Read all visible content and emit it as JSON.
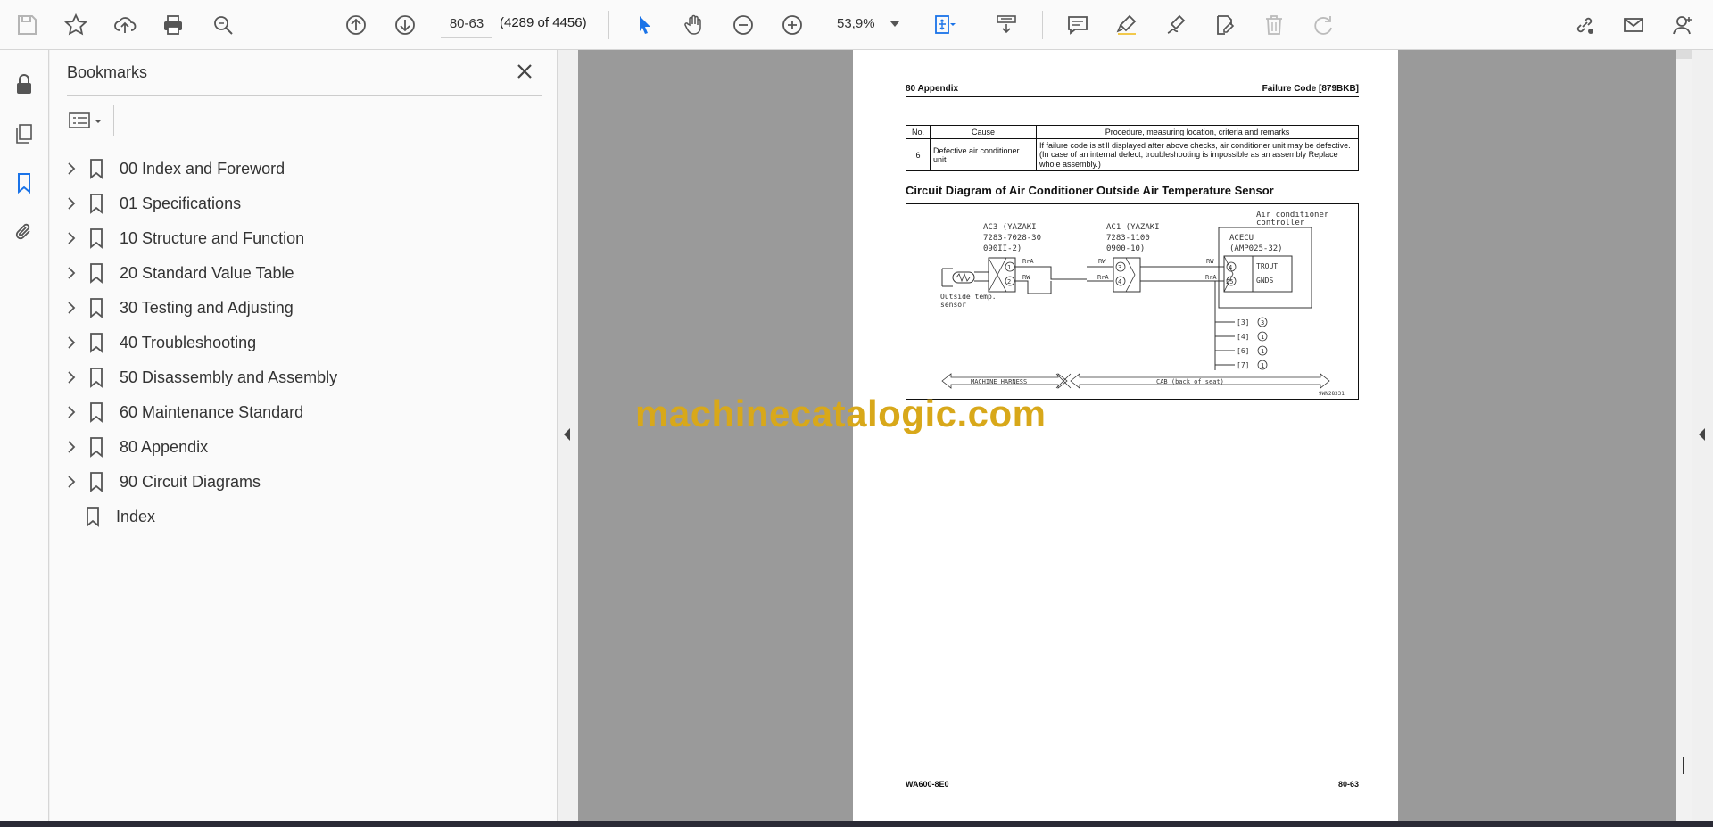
{
  "toolbar": {
    "page_input": "80-63",
    "page_count": "(4289 of 4456)",
    "zoom": "53,9%"
  },
  "panel": {
    "title": "Bookmarks",
    "bookmarks": [
      {
        "label": "00 Index and Foreword"
      },
      {
        "label": "01 Specifications"
      },
      {
        "label": "10 Structure and Function"
      },
      {
        "label": "20 Standard Value Table"
      },
      {
        "label": "30 Testing and Adjusting"
      },
      {
        "label": "40 Troubleshooting"
      },
      {
        "label": "50 Disassembly and Assembly"
      },
      {
        "label": "60 Maintenance Standard"
      },
      {
        "label": "80 Appendix"
      },
      {
        "label": "90 Circuit Diagrams"
      },
      {
        "label": "Index"
      }
    ]
  },
  "doc": {
    "header_left": "80 Appendix",
    "header_right": "Failure Code [879BKB]",
    "table": {
      "headers": [
        "No.",
        "Cause",
        "Procedure, measuring location, criteria and remarks"
      ],
      "row": {
        "no": "6",
        "cause": "Defective air conditioner unit",
        "procedure": "If failure code is still displayed after above checks, air conditioner unit may be defective. (In case of an internal defect, troubleshooting is impossible as an assembly Replace whole assembly.)"
      }
    },
    "section_title": "Circuit Diagram of Air Conditioner Outside Air Temperature Sensor",
    "diagram": {
      "ac3": [
        "AC3 (YAZAKI",
        "7283-7028-30",
        "090II-2)"
      ],
      "ac1": [
        "AC1 (YAZAKI",
        "7283-1100",
        "0900-10)"
      ],
      "acecu": [
        "ACECU",
        "(AMP025-32)"
      ],
      "controller": [
        "Air conditioner",
        "controller"
      ],
      "sensor": [
        "Outside temp.",
        "sensor"
      ],
      "wires": [
        "RrA",
        "RW",
        "RW",
        "RrA",
        "RW",
        "RrA"
      ],
      "pins": [
        "1",
        "2",
        "3",
        "4",
        "4",
        "25"
      ],
      "ecu_labels": [
        "TROUT",
        "GNDS"
      ],
      "branches": [
        "[3]",
        "[4]",
        "[6]",
        "[7]"
      ],
      "branch_nums": [
        "3",
        "1",
        "1",
        "1"
      ],
      "harness_left": "MACHINE HARNESS",
      "harness_right": "CAB (back of seat)",
      "ref": "9WN28331"
    },
    "footer_left": "WA600-8E0",
    "footer_right": "80-63"
  },
  "watermark": "machinecatalogic.com"
}
